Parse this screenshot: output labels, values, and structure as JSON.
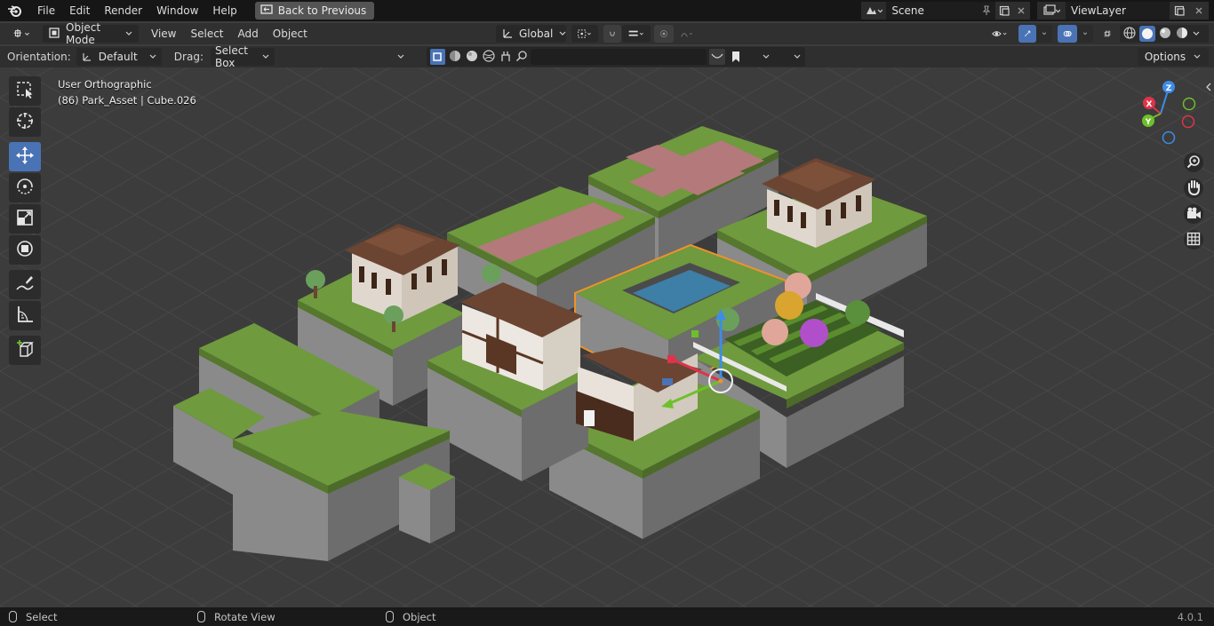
{
  "menubar": {
    "items": [
      "File",
      "Edit",
      "Render",
      "Window",
      "Help"
    ],
    "back_button": "Back to Previous",
    "scene_name": "Scene",
    "view_layer": "ViewLayer"
  },
  "header": {
    "mode": "Object Mode",
    "menus": [
      "View",
      "Select",
      "Add",
      "Object"
    ],
    "transform_orientation": "Global"
  },
  "tool_settings": {
    "orientation_label": "Orientation:",
    "orientation_value": "Default",
    "drag_label": "Drag:",
    "drag_value": "Select Box",
    "search_placeholder": "",
    "options_label": "Options"
  },
  "viewport": {
    "view_name": "User Orthographic",
    "object_info": "(86) Park_Asset | Cube.026",
    "gizmo_axes": {
      "x": "X",
      "y": "Y",
      "z": "Z"
    }
  },
  "status_bar": {
    "left_action": "Select",
    "middle_action": "Rotate View",
    "right_action": "Object",
    "version": "4.0.1"
  },
  "colors": {
    "accent": "#4a73b5",
    "selection": "#f0922a",
    "grass": "#6f9a3e",
    "block_side": "#7c7c7c",
    "path": "#b4797a",
    "water": "#3d7fa6",
    "roof": "#6b4532"
  },
  "icons": {
    "toolbar": [
      "select-box-icon",
      "cursor-icon",
      "move-icon",
      "rotate-icon",
      "scale-icon",
      "transform-icon",
      "annotate-icon",
      "measure-icon",
      "add-cube-icon"
    ],
    "navigation": [
      "zoom-icon",
      "pan-hand-icon",
      "camera-icon",
      "grid-icon"
    ]
  }
}
